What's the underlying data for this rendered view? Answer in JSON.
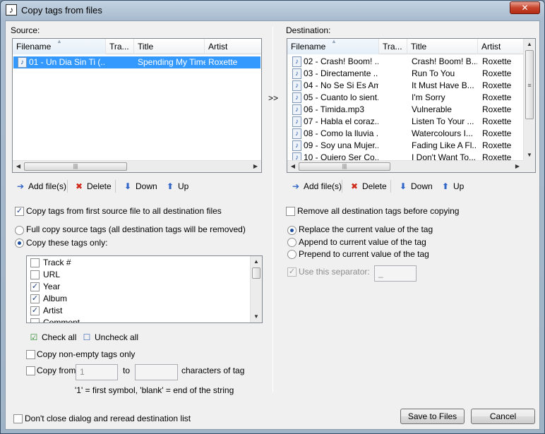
{
  "window": {
    "title": "Copy tags from files",
    "close_label": "✕"
  },
  "source": {
    "label": "Source:",
    "columns": [
      "Filename",
      "Tra...",
      "Title",
      "Artist"
    ],
    "rows": [
      {
        "filename": "01 - Un Dia Sin Ti (...",
        "title": "Spending My Time",
        "artist": "Roxette",
        "selected": true
      }
    ],
    "toolbar": {
      "add": "Add file(s)",
      "delete": "Delete",
      "down": "Down",
      "up": "Up"
    }
  },
  "move_label": ">>",
  "destination": {
    "label": "Destination:",
    "columns": [
      "Filename",
      "Tra...",
      "Title",
      "Artist"
    ],
    "rows": [
      {
        "filename": "02 - Crash! Boom! ...",
        "title": "Crash! Boom! B...",
        "artist": "Roxette"
      },
      {
        "filename": "03 - Directamente ...",
        "title": "Run To You",
        "artist": "Roxette"
      },
      {
        "filename": "04 - No Se Si Es Am...",
        "title": "It Must Have B...",
        "artist": "Roxette"
      },
      {
        "filename": "05 - Cuanto lo sient...",
        "title": "I'm Sorry",
        "artist": "Roxette"
      },
      {
        "filename": "06 - Timida.mp3",
        "title": "Vulnerable",
        "artist": "Roxette"
      },
      {
        "filename": "07 - Habla el coraz...",
        "title": "Listen To Your ...",
        "artist": "Roxette"
      },
      {
        "filename": "08 - Como la lluvia ...",
        "title": "Watercolours I...",
        "artist": "Roxette"
      },
      {
        "filename": "09 - Soy una Mujer...",
        "title": "Fading Like A Fl...",
        "artist": "Roxette"
      },
      {
        "filename": "10 - Quiero Ser Co...",
        "title": "I Don't Want To...",
        "artist": "Roxette"
      }
    ],
    "toolbar": {
      "add": "Add file(s)",
      "delete": "Delete",
      "down": "Down",
      "up": "Up"
    }
  },
  "left_options": {
    "copy_first_to_all": {
      "label": "Copy tags from first source file to all destination files",
      "checked": true
    },
    "full_copy": {
      "label": "Full copy source tags (all destination tags will be removed)",
      "selected": false
    },
    "copy_these": {
      "label": "Copy these tags only:",
      "selected": true
    },
    "tags": [
      {
        "label": "Track #",
        "checked": false
      },
      {
        "label": "URL",
        "checked": false
      },
      {
        "label": "Year",
        "checked": true
      },
      {
        "label": "Album",
        "checked": true
      },
      {
        "label": "Artist",
        "checked": true
      },
      {
        "label": "Comment",
        "checked": false
      }
    ],
    "check_all": "Check all",
    "uncheck_all": "Uncheck all",
    "non_empty": {
      "label": "Copy non-empty tags only",
      "checked": false
    },
    "copy_from": {
      "label": "Copy from",
      "from_value": "1",
      "to_label": "to",
      "to_value": "",
      "suffix": "characters of tag",
      "checked": false
    },
    "hint": "'1' = first symbol, 'blank' = end of the string"
  },
  "right_options": {
    "remove_all": {
      "label": "Remove all destination tags before copying",
      "checked": false
    },
    "replace": {
      "label": "Replace the current value of the tag",
      "selected": true
    },
    "append": {
      "label": "Append to current value of the tag",
      "selected": false
    },
    "prepend": {
      "label": "Prepend to current value of the tag",
      "selected": false
    },
    "separator": {
      "label": "Use this separator:",
      "value": "_",
      "checked": true,
      "disabled": true
    }
  },
  "footer": {
    "dont_close": {
      "label": "Don't close dialog and reread destination list",
      "checked": false
    },
    "save": "Save to Files",
    "cancel": "Cancel"
  }
}
